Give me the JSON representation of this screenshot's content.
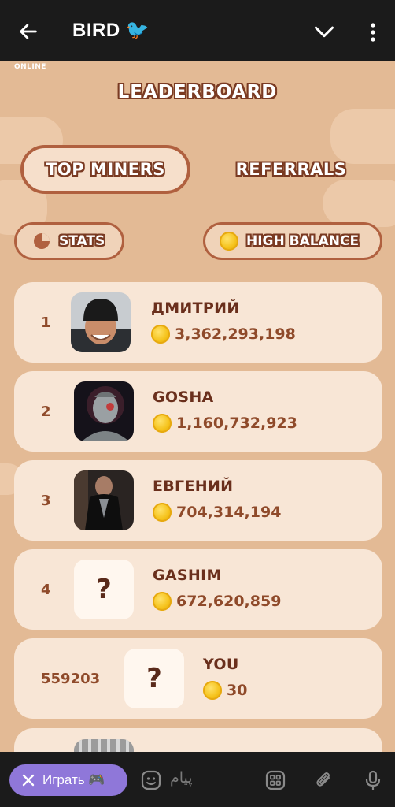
{
  "app_bar": {
    "title": "BIRD 🐦",
    "icons": [
      "back-arrow-icon",
      "chevron-down-icon",
      "more-vertical-icon"
    ]
  },
  "game": {
    "status": "ONLINE",
    "heading": "LEADERBOARD",
    "tabs": [
      {
        "label": "TOP MINERS",
        "active": true
      },
      {
        "label": "REFERRALS",
        "active": false
      }
    ],
    "filters": {
      "stats_label": "STATS",
      "high_balance_label": "HIGH BALANCE"
    },
    "leaderboard": [
      {
        "rank": "1",
        "name": "ДМИТРИЙ",
        "balance": "3,362,293,198",
        "avatar": "photo"
      },
      {
        "rank": "2",
        "name": "GOSHA",
        "balance": "1,160,732,923",
        "avatar": "photo"
      },
      {
        "rank": "3",
        "name": "ЕВГЕНИЙ",
        "balance": "704,314,194",
        "avatar": "photo"
      },
      {
        "rank": "4",
        "name": "GASHIM",
        "balance": "672,620,859",
        "avatar": "?"
      },
      {
        "rank": "559203",
        "name": "YOU",
        "balance": "30",
        "avatar": "?"
      }
    ],
    "colors": {
      "background": "#e3ba95",
      "row": "#f8e6d6",
      "accent_border": "#b0603f",
      "text_dark": "#6a2f1c",
      "text_brown": "#8f4a2a",
      "coin": "#f5c21a"
    }
  },
  "bottom_bar": {
    "play_button": "Играть 🎮",
    "message_placeholder": "پیام",
    "icons": [
      "close-icon",
      "sticker-icon",
      "apps-icon",
      "attach-icon",
      "mic-icon"
    ]
  }
}
